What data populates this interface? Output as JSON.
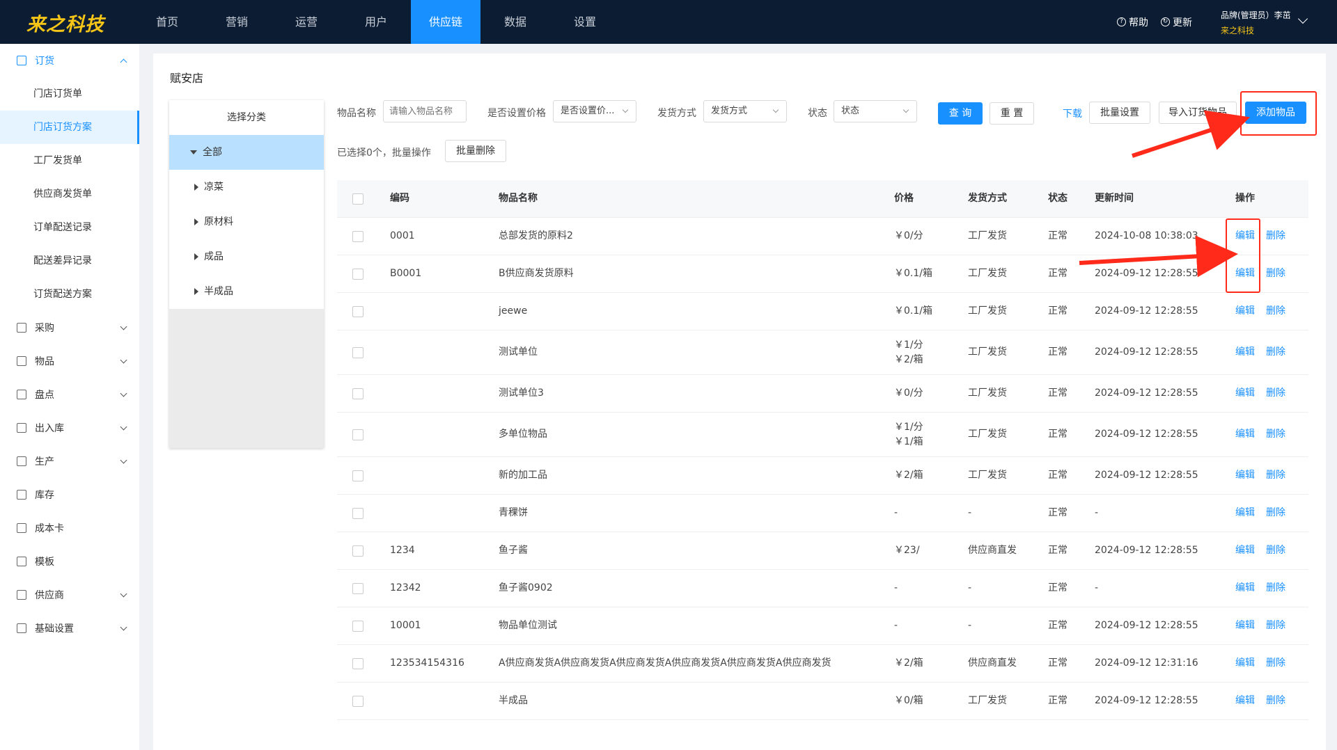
{
  "topbar": {
    "logo": "来之科技",
    "nav": [
      "首页",
      "营销",
      "运营",
      "用户",
      "供应链",
      "数据",
      "设置"
    ],
    "help": "帮助",
    "update": "更新",
    "user_role": "品牌(管理员）李茁",
    "user_brand": "来之科技"
  },
  "sidebar": {
    "order": "订货",
    "order_sub": [
      "门店订货单",
      "门店订货方案",
      "工厂发货单",
      "供应商发货单",
      "订单配送记录",
      "配送差异记录",
      "订货配送方案"
    ],
    "groups": [
      "采购",
      "物品",
      "盘点",
      "出入库",
      "生产",
      "库存",
      "成本卡",
      "模板",
      "供应商",
      "基础设置"
    ]
  },
  "page": {
    "title": "赋安店",
    "category_title": "选择分类",
    "categories": [
      "全部",
      "凉菜",
      "原材料",
      "成品",
      "半成品"
    ]
  },
  "filters": {
    "item_name_label": "物品名称",
    "item_name_placeholder": "请输入物品名称",
    "price_label": "是否设置价格",
    "price_value": "是否设置价...",
    "ship_label": "发货方式",
    "ship_value": "发货方式",
    "status_label": "状态",
    "status_value": "状态",
    "query": "查 询",
    "reset": "重 置",
    "download": "下载",
    "batch_set": "批量设置",
    "import_items": "导入订货物品",
    "add_item": "添加物品"
  },
  "selection": {
    "info": "已选择0个，批量操作",
    "batch_delete": "批量删除"
  },
  "table": {
    "headers": {
      "code": "编码",
      "name": "物品名称",
      "price": "价格",
      "ship": "发货方式",
      "status": "状态",
      "time": "更新时间",
      "op": "操作"
    },
    "edit": "编辑",
    "delete": "删除",
    "rows": [
      {
        "code": "0001",
        "name": "总部发货的原料2",
        "price": [
          "￥0/分"
        ],
        "ship": "工厂发货",
        "status": "正常",
        "time": "2024-10-08 10:38:03"
      },
      {
        "code": "B0001",
        "name": "B供应商发货原料",
        "price": [
          "￥0.1/箱"
        ],
        "ship": "工厂发货",
        "status": "正常",
        "time": "2024-09-12 12:28:55"
      },
      {
        "code": "",
        "name": "jeewe",
        "price": [
          "￥0.1/箱"
        ],
        "ship": "工厂发货",
        "status": "正常",
        "time": "2024-09-12 12:28:55"
      },
      {
        "code": "",
        "name": "测试单位",
        "price": [
          "￥1/分",
          "￥2/箱"
        ],
        "ship": "工厂发货",
        "status": "正常",
        "time": "2024-09-12 12:28:55"
      },
      {
        "code": "",
        "name": "测试单位3",
        "price": [
          "￥0/分"
        ],
        "ship": "工厂发货",
        "status": "正常",
        "time": "2024-09-12 12:28:55"
      },
      {
        "code": "",
        "name": "多单位物品",
        "price": [
          "￥1/分",
          "￥1/箱"
        ],
        "ship": "工厂发货",
        "status": "正常",
        "time": "2024-09-12 12:28:55"
      },
      {
        "code": "",
        "name": "新的加工品",
        "price": [
          "￥2/箱"
        ],
        "ship": "工厂发货",
        "status": "正常",
        "time": "2024-09-12 12:28:55"
      },
      {
        "code": "",
        "name": "青稞饼",
        "price": [
          "-"
        ],
        "ship": "-",
        "status": "正常",
        "time": "-"
      },
      {
        "code": "1234",
        "name": "鱼子酱",
        "price": [
          "￥23/"
        ],
        "ship": "供应商直发",
        "status": "正常",
        "time": "2024-09-12 12:28:55"
      },
      {
        "code": "12342",
        "name": "鱼子酱0902",
        "price": [
          "-"
        ],
        "ship": "-",
        "status": "正常",
        "time": "-"
      },
      {
        "code": "10001",
        "name": "物品单位测试",
        "price": [
          "-"
        ],
        "ship": "-",
        "status": "正常",
        "time": "2024-09-12 12:28:55"
      },
      {
        "code": "123534154316",
        "name": "A供应商发货A供应商发货A供应商发货A供应商发货A供应商发货A供应商发货",
        "price": [
          "￥2/箱"
        ],
        "ship": "供应商直发",
        "status": "正常",
        "time": "2024-09-12 12:31:16"
      },
      {
        "code": "",
        "name": "半成品",
        "price": [
          "￥0/箱"
        ],
        "ship": "工厂发货",
        "status": "正常",
        "time": "2024-09-12 12:28:55"
      }
    ]
  },
  "colors": {
    "accent": "#1890ff",
    "topbar": "#0c1c33",
    "logo": "#f5c518",
    "annotation": "#ff2a1a"
  }
}
